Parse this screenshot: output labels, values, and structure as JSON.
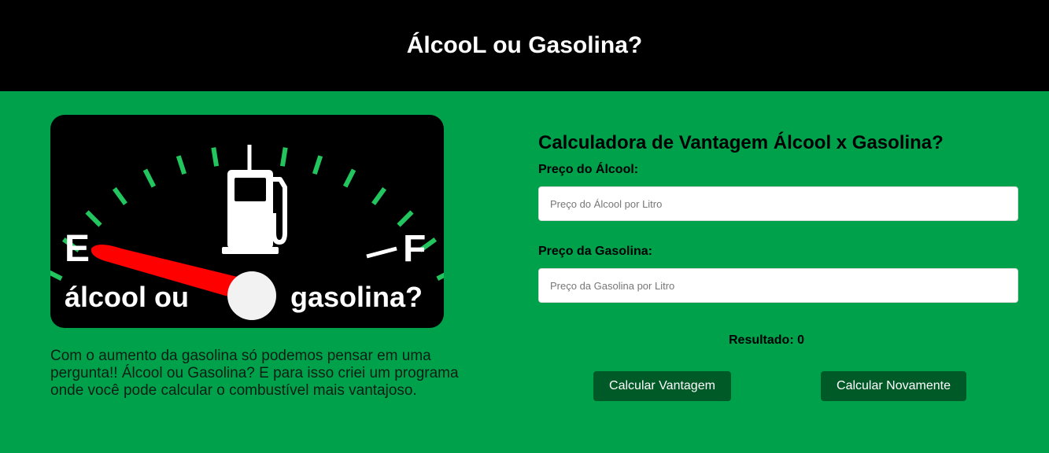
{
  "header": {
    "title": "ÁlcooL ou Gasolina?"
  },
  "gauge_image": {
    "empty_letter": "E",
    "full_letter": "F",
    "left_caption": "álcool ou",
    "right_caption": "gasolina?",
    "colors": {
      "background": "#000000",
      "ticks": "#22c55e",
      "needle": "#ff0000",
      "pump": "#ffffff"
    }
  },
  "description": "Com o aumento da gasolina só podemos pensar em uma pergunta!! Álcool ou Gasolina? E para isso criei um programa onde você pode calcular o combustível mais vantajoso.",
  "calculator": {
    "title": "Calculadora de Vantagem Álcool x Gasolina?",
    "alcohol_label": "Preço do Álcool:",
    "alcohol_placeholder": "Preço do Álcool por Litro",
    "alcohol_value": "",
    "gasoline_label": "Preço da Gasolina:",
    "gasoline_placeholder": "Preço da Gasolina por Litro",
    "gasoline_value": "",
    "result_text": "Resultado: 0",
    "calculate_button": "Calcular Vantagem",
    "reset_button": "Calcular Novamente"
  },
  "colors": {
    "page_background": "#00a14b",
    "header_background": "#000000",
    "button_background": "#005a28"
  }
}
